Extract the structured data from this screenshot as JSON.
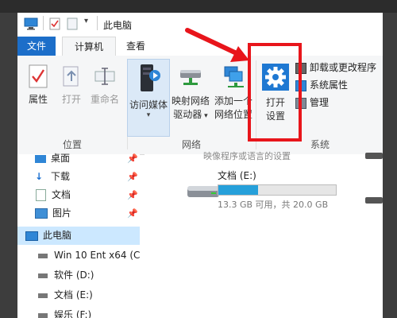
{
  "window": {
    "title": "此电脑"
  },
  "tabs": [
    {
      "label": "文件"
    },
    {
      "label": "计算机"
    },
    {
      "label": "查看"
    }
  ],
  "ribbon": {
    "location_group": {
      "label": "位置",
      "buttons": [
        {
          "label": "属性",
          "enabled": true
        },
        {
          "label": "打开",
          "enabled": false
        },
        {
          "label": "重命名",
          "enabled": false
        }
      ]
    },
    "network_group": {
      "label": "网络",
      "buttons": [
        {
          "label": "访问媒体"
        },
        {
          "label_line1": "映射网络",
          "label_line2": "驱动器"
        },
        {
          "label_line1": "添加一个",
          "label_line2": "网络位置"
        }
      ]
    },
    "system_group": {
      "label": "系统",
      "open_settings_line1": "打开",
      "open_settings_line2": "设置",
      "items": [
        {
          "label": "卸载或更改程序"
        },
        {
          "label": "系统属性"
        },
        {
          "label": "管理"
        }
      ]
    }
  },
  "nav_pane": {
    "items": [
      {
        "label": "桌面"
      },
      {
        "label": "下载"
      },
      {
        "label": "文档"
      },
      {
        "label": "图片"
      },
      {
        "label": "此电脑"
      },
      {
        "label": "Win 10 Ent x64 (C"
      },
      {
        "label": "软件 (D:)"
      },
      {
        "label": "文档 (E:)"
      },
      {
        "label": "娱乐 (F:)"
      }
    ]
  },
  "content": {
    "partial_text": "映像程序或语言的设置",
    "drive": {
      "name": "文档 (E:)",
      "usage": "13.3 GB 可用，共 20.0 GB",
      "used_fraction": 0.335
    }
  },
  "colors": {
    "accent": "#1c6ec9",
    "annotation": "#e8151b",
    "gear": "#1e78d2",
    "bar_fill": "#26a0da"
  }
}
